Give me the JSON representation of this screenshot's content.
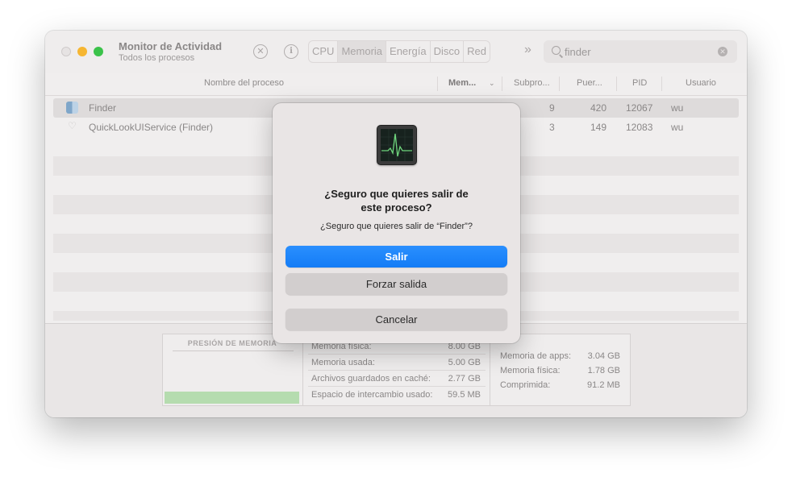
{
  "window": {
    "title": "Monitor de Actividad",
    "subtitle": "Todos los procesos",
    "tabs": [
      "CPU",
      "Memoria",
      "Energía",
      "Disco",
      "Red"
    ],
    "active_tab": "Memoria",
    "search_value": "finder"
  },
  "table": {
    "columns": [
      "Nombre del proceso",
      "Mem...",
      "Subpro...",
      "Puer...",
      "PID",
      "Usuario"
    ],
    "rows": [
      {
        "name": "Finder",
        "memory": "",
        "threads": "9",
        "ports": "420",
        "pid": "12067",
        "user": "wu"
      },
      {
        "name": "QuickLookUIService (Finder)",
        "memory": "",
        "threads": "3",
        "ports": "149",
        "pid": "12083",
        "user": "wu"
      }
    ]
  },
  "memory_stats": {
    "pressure_label": "PRESIÓN DE MEMORIA",
    "middle": [
      {
        "label": "Memoria física:",
        "value": "8.00 GB"
      },
      {
        "label": "Memoria usada:",
        "value": "5.00 GB"
      },
      {
        "label": "Archivos guardados en caché:",
        "value": "2.77 GB"
      },
      {
        "label": "Espacio de intercambio usado:",
        "value": "59.5 MB"
      }
    ],
    "right": [
      {
        "label": "Memoria de apps:",
        "value": "3.04 GB"
      },
      {
        "label": "Memoria física:",
        "value": "1.78 GB"
      },
      {
        "label": "Comprimida:",
        "value": "91.2 MB"
      }
    ]
  },
  "dialog": {
    "title_line1": "¿Seguro que quieres salir de",
    "title_line2": "este proceso?",
    "message": "¿Seguro que quieres salir de “Finder”?",
    "quit_label": "Salir",
    "force_quit_label": "Forzar salida",
    "cancel_label": "Cancelar",
    "accent_color": "#1a84fa"
  }
}
